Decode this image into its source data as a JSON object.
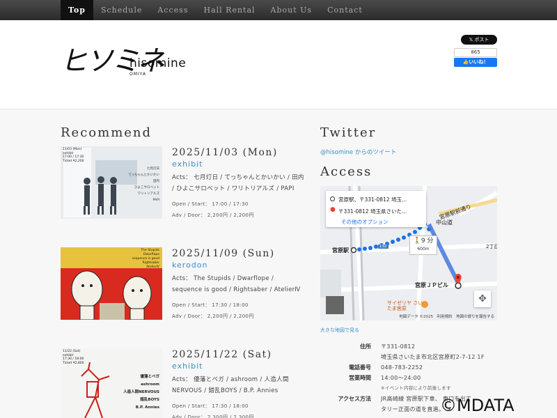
{
  "nav": {
    "items": [
      "Top",
      "Schedule",
      "Access",
      "Hall Rental",
      "About Us",
      "Contact"
    ]
  },
  "header": {
    "logo_kana": "ヒソミネ",
    "logo_latin": "hisomine",
    "logo_sub": "OMIYA",
    "tweet_label": "ポスト",
    "fb_count": "865",
    "fb_like": "いいね！"
  },
  "recommend": {
    "title": "Recommend",
    "events": [
      {
        "date": "2025/11/03 (Mon)",
        "category": "exhibit",
        "acts": "Acts： 七月灯日 / てっちゃんとかいかい / 田内 / ひよこサロベット / ワリトリアルズ / PAPI",
        "open_start": "Open / Start： 17:00 / 17:30",
        "adv_door": "Adv / Door： 2,200円 / 2,200円",
        "thumb_text": [
          "11/03 (Mon)",
          "exhibit",
          "17:00 / 17:30",
          "Ticket ¥2,200",
          "七月灯日",
          "てっちゃんとかいかい",
          "田内",
          "ひよこサロベット",
          "ワリトリアルズ",
          "PAPI"
        ]
      },
      {
        "date": "2025/11/09 (Sun)",
        "category": "kerodon",
        "acts": "Acts： The Stupids / Dwarflope / sequence is good / Rightsaber / AtelierⅣ",
        "open_start": "Open / Start： 17:30 / 18:00",
        "adv_door": "Adv / Door： 2,200円 / 2,200円",
        "thumb_text": [
          "The Stupids",
          "Dwarflope",
          "sequence is good",
          "Rightsaber",
          "AtelierⅣ"
        ]
      },
      {
        "date": "2025/11/22 (Sat)",
        "category": "exhibit",
        "acts": "Acts： 優藩とベガ / ashroom / 人造人間NERVOUS / 錯乱BOYS / B.P. Annies",
        "open_start": "Open / Start： 17:30 / 18:00",
        "adv_door": "Adv / Door： 2,300円 / 2,300円",
        "thumb_text": [
          "11/22 (Sat)",
          "exhibit",
          "17:30 / 18:00",
          "Ticket ¥2,800",
          "優藩とベガ",
          "ashroom",
          "人造人間NERVOUS",
          "錯乱BOYS",
          "B.P. Annies"
        ]
      }
    ]
  },
  "twitter": {
    "title": "Twitter",
    "link": "@hisomine からのツイート"
  },
  "access": {
    "title": "Access",
    "map": {
      "from": "宮原駅、〒331-0812 埼玉...",
      "to": "〒331-0812 埼玉県さいた...",
      "options": "その他のオプション",
      "walk_time": "9 分",
      "walk_dist": "600m",
      "station": "宮原駅",
      "building": "宮原ＪＰビル",
      "road1": "宮原駅前通り",
      "road2": "中山道",
      "shop": "サイゼリヤ さいたま宮原",
      "chome": "2丁目",
      "route": "132",
      "footer": "地図データ ©2025　利用規約　地図の誤りを報告する",
      "big_link": "大きな地図で見る"
    },
    "info": [
      {
        "key": "住所",
        "value": "〒331-0812"
      },
      {
        "key": "",
        "value": "埼玉県さいたま市北区宮原町2-7-12 1F"
      },
      {
        "key": "電話番号",
        "value": "048-783-2252"
      },
      {
        "key": "営業時間",
        "value": "14:00～24:00"
      },
      {
        "key": "",
        "value": "※イベント内容により前後します"
      },
      {
        "key": "アクセス方法",
        "value": "JR高崎線 宮原駅下車、 東口を出て"
      },
      {
        "key": "",
        "value": "タリー正面の道を直進。 メ"
      }
    ]
  },
  "watermark": "©MDATA"
}
